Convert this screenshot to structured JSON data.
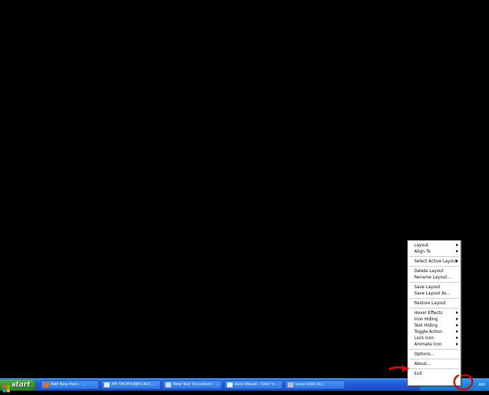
{
  "context_menu": {
    "groups": [
      [
        {
          "label": "Layout",
          "submenu": true
        },
        {
          "label": "Align To",
          "submenu": true
        }
      ],
      [
        {
          "label": "Select Active Layout",
          "submenu": true
        }
      ],
      [
        {
          "label": "Delete Layout",
          "submenu": false
        },
        {
          "label": "Rename Layout...",
          "submenu": false
        }
      ],
      [
        {
          "label": "Save Layout",
          "submenu": false
        },
        {
          "label": "Save Layout As...",
          "submenu": false
        }
      ],
      [
        {
          "label": "Restore Layout",
          "submenu": false
        }
      ],
      [
        {
          "label": "Hover Effects",
          "submenu": true
        },
        {
          "label": "Icon Hiding",
          "submenu": true
        },
        {
          "label": "Text Hiding",
          "submenu": true
        },
        {
          "label": "Toggle Action",
          "submenu": true
        },
        {
          "label": "Lock Icon",
          "submenu": true
        },
        {
          "label": "Animate Icon",
          "submenu": true
        }
      ],
      [
        {
          "label": "Options...",
          "submenu": false
        }
      ],
      [
        {
          "label": "About...",
          "submenu": false
        }
      ],
      [
        {
          "label": "Exit",
          "submenu": false
        }
      ]
    ]
  },
  "taskbar": {
    "start_label": "start",
    "tasks": [
      {
        "label": "Add New Post ‹ …",
        "icon": "firefox-icon",
        "color": "#d9712b"
      },
      {
        "label": "MY TECHTUNES ACC...",
        "icon": "document-icon",
        "color": "#e8e8e8"
      },
      {
        "label": "New Text Document - ...",
        "icon": "notepad-icon",
        "color": "#bfe0ff"
      },
      {
        "label": "Avro Mouse - Click 'n ...",
        "icon": "mouse-icon",
        "color": "#f0f0f0"
      },
      {
        "label": "Local Disk (G:)",
        "icon": "drive-icon",
        "color": "#c0c0c0"
      }
    ],
    "clock": "AM"
  },
  "colors": {
    "desktop": "#000000",
    "annotation": "#e00000"
  }
}
